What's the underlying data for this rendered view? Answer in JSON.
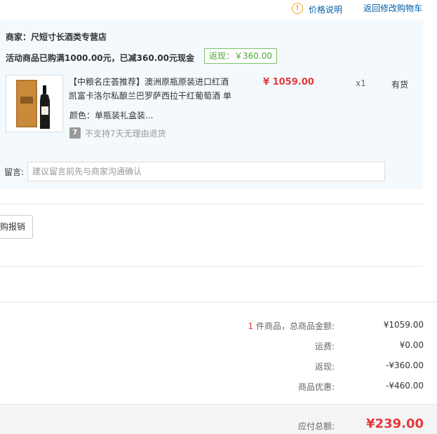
{
  "top_links": {
    "price_info_icon": "!",
    "price_info": "价格说明",
    "back_to_cart": "返回修改购物车"
  },
  "shop": {
    "name": "商家：尺短寸长酒类专营店",
    "promotion": "活动商品已购满1000.00元，已减360.00元现金",
    "rebate_badge": "返现：￥360.00"
  },
  "product": {
    "title": "【中粮名庄荟推荐】澳洲原瓶原装进口红酒凯富卡洛尔私酿兰巴罗萨西拉干红葡萄酒 单瓶装礼盒装",
    "price": "¥ 1059.00",
    "quantity": "x1",
    "stock": "有货",
    "attr_label": "颜色：",
    "attr_value": "单瓶装礼盒装...",
    "return_icon": "7",
    "return_policy": "不支持7天无理由退货"
  },
  "message": {
    "label": "留言:",
    "placeholder": "建议留言前先与商家沟通确认"
  },
  "partial_button": "购报销",
  "summary": {
    "count": "1",
    "count_label": "件商品，总商品金额:",
    "goods_total": "¥1059.00",
    "shipping_label": "运费:",
    "shipping": "¥0.00",
    "rebate_label": "返现:",
    "rebate": "-¥360.00",
    "discount_label": "商品优惠:",
    "discount": "-¥460.00",
    "payable_label": "应付总额:",
    "payable": "¥239.00"
  },
  "colors": {
    "accent_red": "#e4393c",
    "link_blue": "#005ea7",
    "rebate_green": "#4fa43a",
    "panel_bg": "#f3f9fd"
  }
}
